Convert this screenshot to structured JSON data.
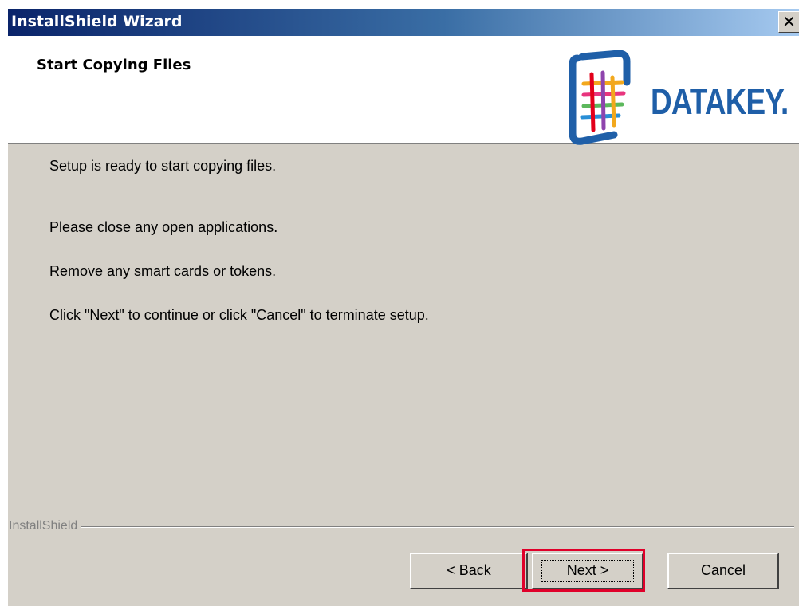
{
  "window": {
    "title": "InstallShield Wizard",
    "close_glyph": "✕"
  },
  "header": {
    "title": "Start Copying Files",
    "logo_text": "DATAKEY."
  },
  "body": {
    "lines": [
      "Setup is ready to start copying files.",
      "Please close any open applications.",
      "Remove any smart cards or tokens.",
      "Click \"Next\" to continue or click \"Cancel\" to terminate setup."
    ]
  },
  "footer": {
    "group_label": "InstallShield"
  },
  "buttons": {
    "back_prefix": "< ",
    "back_accel": "B",
    "back_rest": "ack",
    "next_accel": "N",
    "next_rest": "ext >",
    "cancel": "Cancel"
  },
  "colors": {
    "highlight": "#e0002a",
    "logo_blue": "#1f5fa8"
  }
}
